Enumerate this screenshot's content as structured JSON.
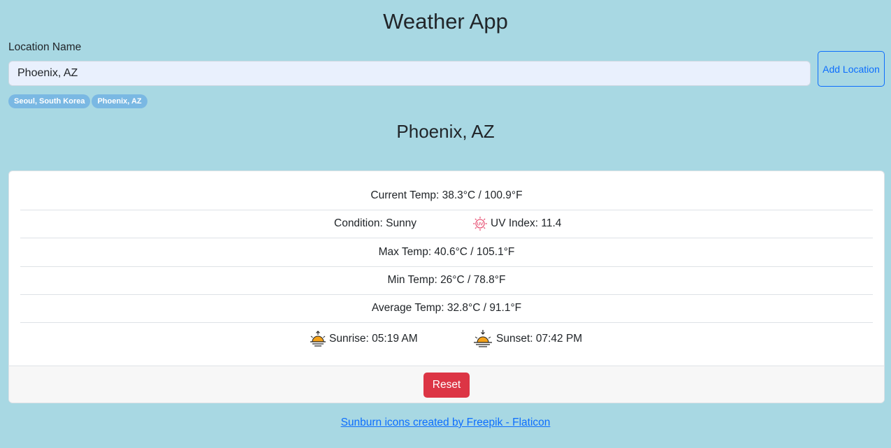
{
  "app": {
    "title": "Weather App"
  },
  "form": {
    "label": "Location Name",
    "input_value": "Phoenix, AZ",
    "add_button_label": "Add Location"
  },
  "saved_locations": [
    "Seoul, South Korea",
    "Phoenix, AZ"
  ],
  "current_location": "Phoenix, AZ",
  "weather": {
    "current_temp": "Current Temp: 38.3°C / 100.9°F",
    "condition": "Condition: Sunny",
    "uv_index": "UV Index: 11.4",
    "max_temp": "Max Temp: 40.6°C / 105.1°F",
    "min_temp": "Min Temp: 26°C / 78.8°F",
    "average_temp": "Average Temp: 32.8°C / 91.1°F",
    "sunrise": "Sunrise: 05:19 AM",
    "sunset": "Sunset: 07:42 PM"
  },
  "icons": {
    "uv": "uv-sun-icon",
    "sunrise": "sunrise-icon",
    "sunset": "sunset-icon"
  },
  "footer": {
    "reset_label": "Reset"
  },
  "credit": {
    "link_text": "Sunburn icons created by Freepik - Flaticon"
  },
  "colors": {
    "background": "#a8d8e3",
    "chip": "#7ab8e3",
    "primary": "#0d6efd",
    "danger": "#dc3545",
    "sun": "#f4a21b"
  }
}
